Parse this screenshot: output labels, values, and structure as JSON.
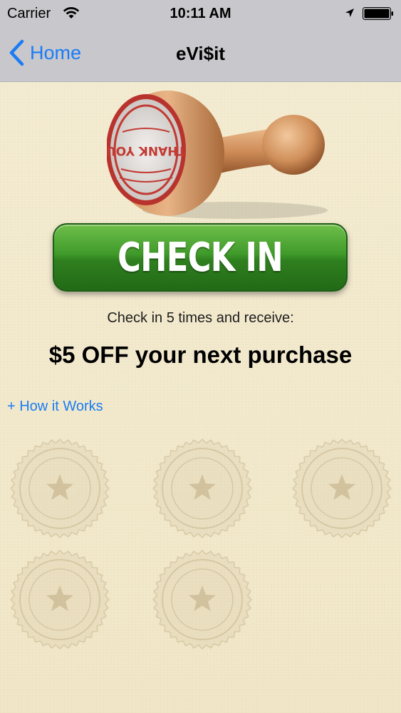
{
  "status_bar": {
    "carrier": "Carrier",
    "time": "10:11 AM",
    "icons": [
      "wifi-icon",
      "location-icon",
      "battery-icon"
    ]
  },
  "nav": {
    "back_label": "Home",
    "title": "eVi$it",
    "back_icon": "chevron-left-icon"
  },
  "main": {
    "stamp_text": "THANK YOU",
    "checkin_label": "CHECK IN",
    "subtitle": "Check in 5 times and receive:",
    "reward": "$5 OFF your next purchase",
    "how_link": "+ How it Works",
    "badges": {
      "total": 5,
      "earned": 0,
      "icon": "star-seal-icon"
    }
  },
  "colors": {
    "accent": "#1a7cf5",
    "button_green": "#3f9a2a",
    "background": "#f3ebcf",
    "navbar": "#c7c7cc"
  }
}
